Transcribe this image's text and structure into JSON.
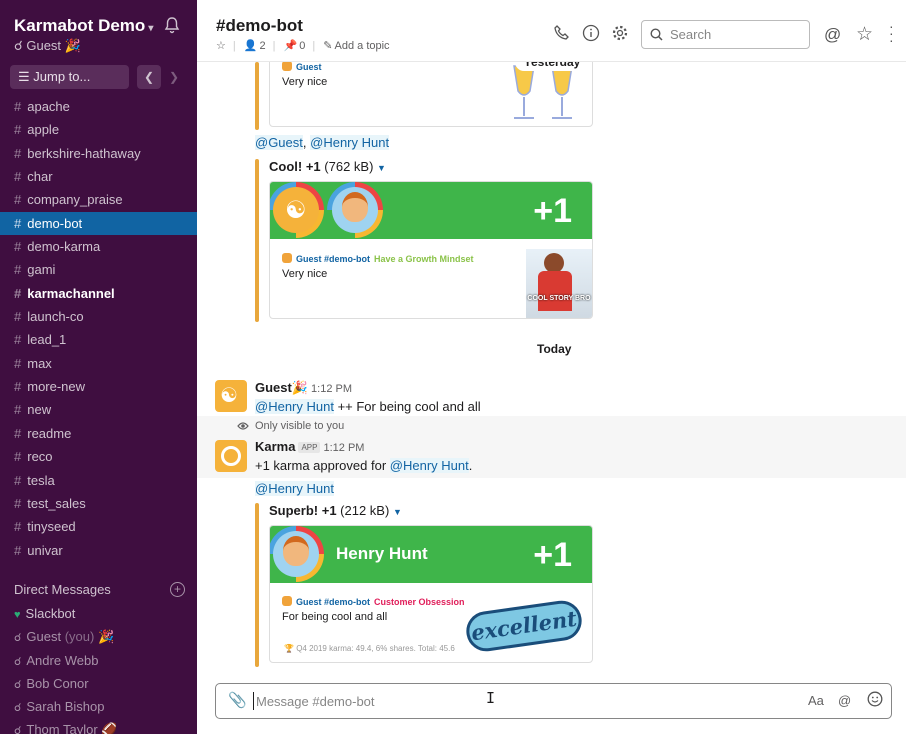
{
  "workspace": {
    "name": "Karmabot Demo",
    "user": "Guest",
    "user_emoji": "🎉"
  },
  "sidebar": {
    "jump_label": "Jump to...",
    "channels": [
      {
        "name": "apache"
      },
      {
        "name": "apple"
      },
      {
        "name": "berkshire-hathaway"
      },
      {
        "name": "char"
      },
      {
        "name": "company_praise"
      },
      {
        "name": "demo-bot",
        "active": true
      },
      {
        "name": "demo-karma"
      },
      {
        "name": "gami"
      },
      {
        "name": "karmachannel",
        "bold": true
      },
      {
        "name": "launch-co"
      },
      {
        "name": "lead_1"
      },
      {
        "name": "max"
      },
      {
        "name": "more-new"
      },
      {
        "name": "new"
      },
      {
        "name": "readme"
      },
      {
        "name": "reco"
      },
      {
        "name": "tesla"
      },
      {
        "name": "test_sales"
      },
      {
        "name": "tinyseed"
      },
      {
        "name": "univar"
      }
    ],
    "dm_header": "Direct Messages",
    "dms": [
      {
        "name": "Slackbot",
        "status": "heart",
        "online": true
      },
      {
        "name": "Guest",
        "suffix": "(you)",
        "emoji": "🎉"
      },
      {
        "name": "Andre Webb"
      },
      {
        "name": "Bob Conor"
      },
      {
        "name": "Sarah Bishop"
      },
      {
        "name": "Thom Taylor",
        "emoji": "🏈"
      }
    ]
  },
  "header": {
    "title": "#demo-bot",
    "members": "2",
    "pins": "0",
    "add_topic": "Add a topic",
    "search_placeholder": "Search"
  },
  "messages": {
    "prev_card": {
      "sender": "Guest",
      "text": "Very nice"
    },
    "yesterday_label": "Yesterday",
    "mention_line": {
      "m1": "@Guest",
      "comma": ",",
      "m2": "@Henry Hunt"
    },
    "cool_card": {
      "title": "Cool! +1",
      "size": "(762 kB)",
      "plus": "+1",
      "sender": "Guest #demo-bot",
      "value": "Have a Growth Mindset",
      "text": "Very nice",
      "gif_caption": "COOL STORY BRO"
    },
    "today_label": "Today",
    "guest_msg": {
      "sender": "Guest",
      "emoji": "🎉",
      "time": "1:12 PM",
      "mention": "@Henry Hunt",
      "text": " ++ For being cool and all"
    },
    "ephemeral_label": "Only visible to you",
    "karma_msg": {
      "sender": "Karma",
      "badge": "APP",
      "time": "1:12 PM",
      "text": "+1 karma approved for ",
      "mention": "@Henry Hunt",
      "dot": "."
    },
    "karma_mention": "@Henry Hunt",
    "superb_card": {
      "title": "Superb! +1",
      "size": "(212 kB)",
      "name": "Henry Hunt",
      "plus": "+1",
      "sender": "Guest #demo-bot",
      "value": "Customer Obsession",
      "text": "For being cool and all",
      "footer": "Q4 2019 karma: 49.4, 6% shares. Total: 45.6",
      "sticker": "excellent"
    }
  },
  "composer": {
    "placeholder": "Message #demo-bot",
    "format_label": "Aa",
    "at_label": "@"
  },
  "colors": {
    "sidebar": "#3f0e40",
    "active": "#1164a3",
    "karma_green": "#3fb54a",
    "quote_bar": "#e8a73c"
  }
}
